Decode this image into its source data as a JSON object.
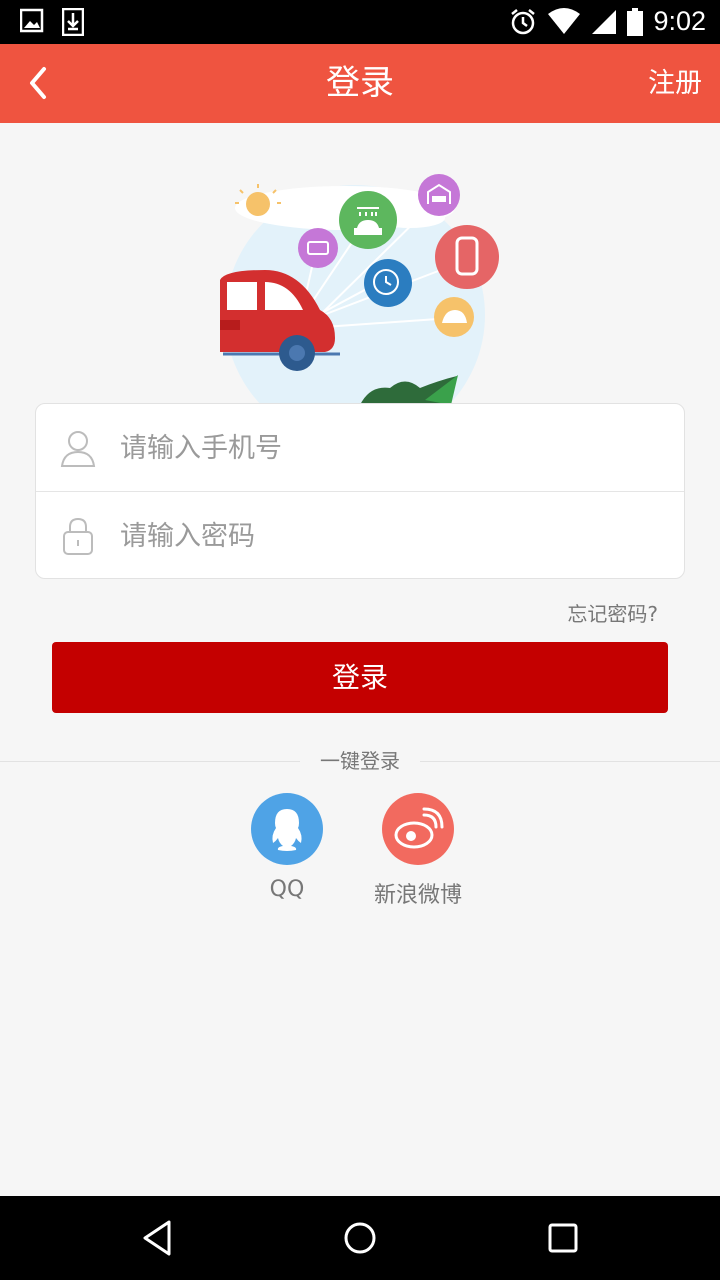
{
  "status_bar": {
    "time": "9:02",
    "icons": [
      "image-icon",
      "download-icon",
      "alarm-icon",
      "wifi-icon",
      "signal-icon",
      "battery-icon"
    ]
  },
  "header": {
    "title": "登录",
    "register_label": "注册",
    "background_color": "#ef5440"
  },
  "form": {
    "phone_placeholder": "请输入手机号",
    "password_placeholder": "请输入密码",
    "forgot_label": "忘记密码?"
  },
  "login_button": {
    "label": "登录",
    "color": "#c40000"
  },
  "quick_login": {
    "label": "一键登录",
    "providers": [
      {
        "label": "QQ",
        "icon": "qq-icon",
        "color": "#4fa3e6"
      },
      {
        "label": "新浪微博",
        "icon": "weibo-icon",
        "color": "#f26a5f"
      }
    ]
  },
  "nav_bar": {
    "icons": [
      "back-nav-icon",
      "home-nav-icon",
      "recents-nav-icon"
    ]
  }
}
